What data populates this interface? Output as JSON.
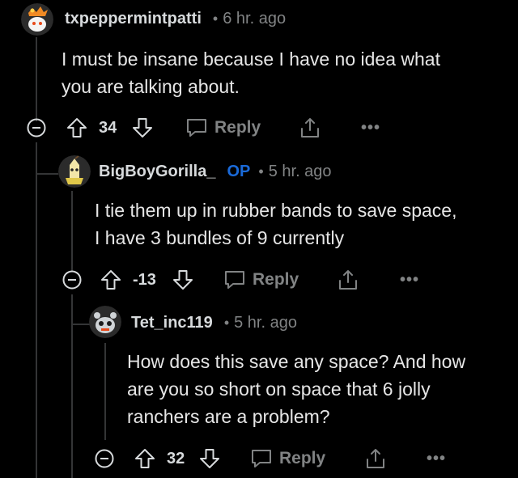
{
  "comments": [
    {
      "username": "txpeppermintpatti",
      "op_badge": "",
      "separator": "•",
      "time": "6 hr. ago",
      "body": [
        "I must be insane because I have no idea what",
        "you are talking about."
      ],
      "score": "34",
      "reply_label": "Reply",
      "more_label": "•••"
    },
    {
      "username": "BigBoyGorilla_",
      "op_badge": "OP",
      "separator": "•",
      "time": "5 hr. ago",
      "body": [
        "I tie them up in rubber bands to save space,",
        "I have 3 bundles of 9 currently"
      ],
      "score": "-13",
      "reply_label": "Reply",
      "more_label": "•••"
    },
    {
      "username": "Tet_inc119",
      "op_badge": "",
      "separator": "•",
      "time": "5 hr. ago",
      "body": [
        "How does this save any space? And how",
        "are you so short on space that 6 jolly",
        "ranchers are a problem?"
      ],
      "score": "32",
      "reply_label": "Reply",
      "more_label": "•••"
    }
  ],
  "icons": {
    "collapse": "minus-circle-icon",
    "upvote": "arrow-up-icon",
    "downvote": "arrow-down-icon",
    "reply": "speech-bubble-icon",
    "share": "share-icon",
    "more": "ellipsis-icon"
  },
  "colors": {
    "background": "#000000",
    "username": "#d7dadc",
    "op_badge": "#1a6ad9",
    "meta": "#818384",
    "thread_line": "#343536"
  }
}
